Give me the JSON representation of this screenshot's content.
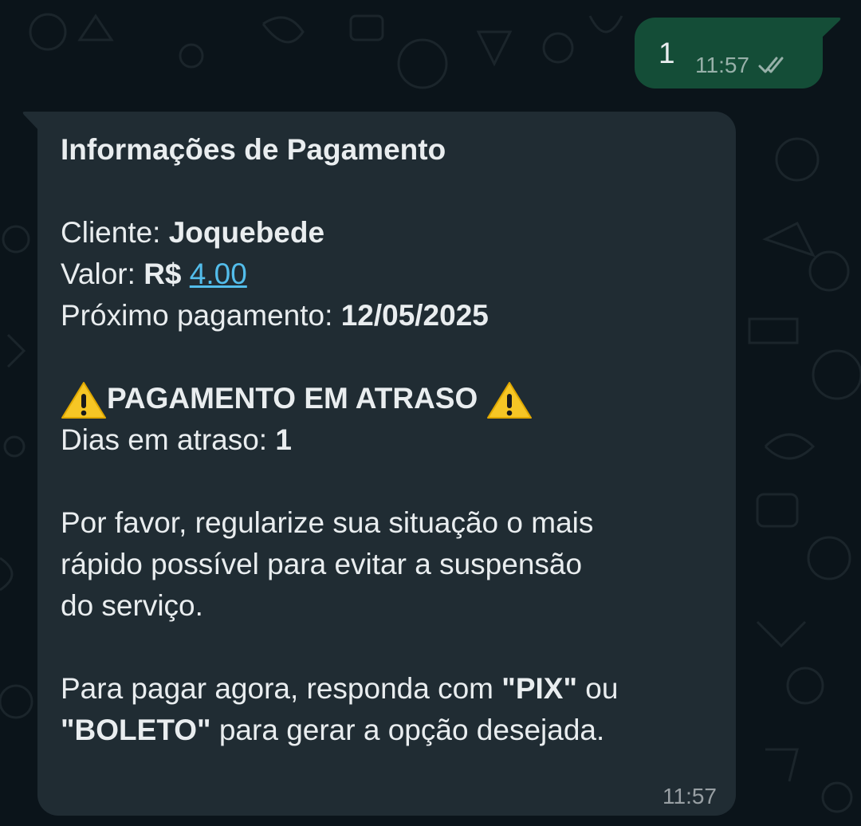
{
  "chat": {
    "outgoing": {
      "text": "1",
      "time": "11:57",
      "status_icon": "double-check-icon"
    },
    "incoming": {
      "title": "Informações de Pagamento",
      "client_label": "Cliente: ",
      "client_name": "Joquebede",
      "amount_label": "Valor: ",
      "currency": "R$ ",
      "amount": "4.00",
      "next_payment_label": "Próximo pagamento: ",
      "next_payment_date": "12/05/2025",
      "overdue_title": "PAGAMENTO EM ATRASO",
      "warning_icon": "warning-icon",
      "days_label": "Dias em atraso: ",
      "days_value": "1",
      "notice_line1": "Por favor, regularize sua situação o mais",
      "notice_line2": "rápido possível para evitar a suspensão",
      "notice_line3": "do serviço.",
      "pay_line1_prefix": "Para pagar agora, responda com ",
      "pay_option_pix": "\"PIX\"",
      "pay_line1_suffix": " ou",
      "pay_option_boleto": "\"BOLETO\"",
      "pay_line2_suffix": " para gerar a opção desejada.",
      "time": "11:57"
    }
  },
  "colors": {
    "background": "#0b141a",
    "incoming_bubble": "#202c33",
    "outgoing_bubble": "#144d37",
    "link": "#53bdeb",
    "text": "#e9edef"
  }
}
